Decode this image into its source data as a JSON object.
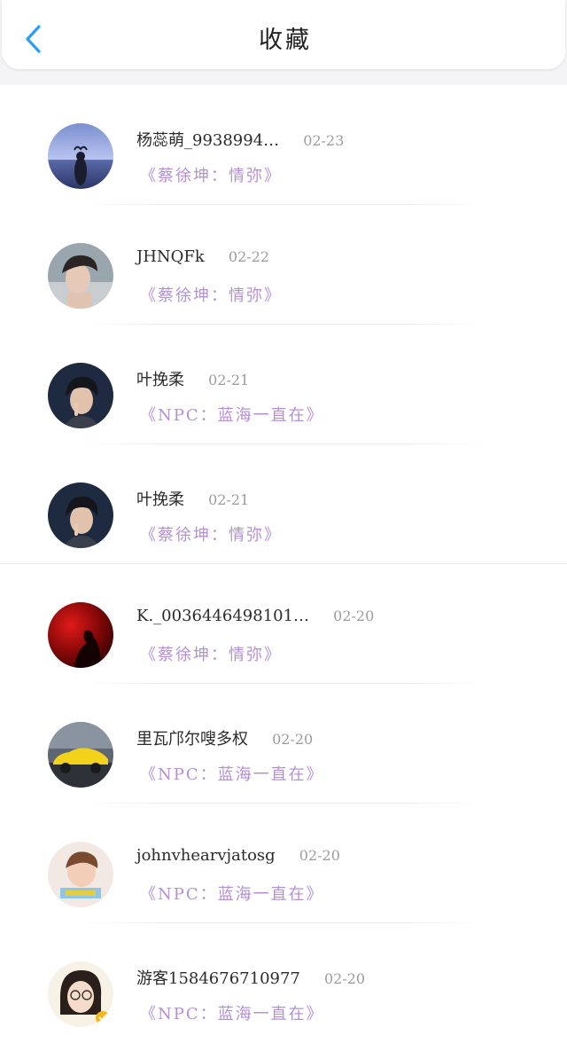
{
  "header": {
    "title": "收藏",
    "back_icon": "chevron-left-icon",
    "accent_color": "#2a9df4"
  },
  "link_color": "#b48fd8",
  "favorites": [
    {
      "username": "杨蕊萌_9938994…",
      "date": "02-23",
      "work": "《蔡徐坤：情弥》",
      "avatar": "sunset-heart-photo"
    },
    {
      "username": "JHNQFk",
      "date": "02-22",
      "work": "《蔡徐坤：情弥》",
      "avatar": "boy-portrait-photo"
    },
    {
      "username": "叶挽柔",
      "date": "02-21",
      "work": "《NPC：蓝海一直在》",
      "avatar": "boy-shush-photo"
    },
    {
      "username": "叶挽柔",
      "date": "02-21",
      "work": "《蔡徐坤：情弥》",
      "avatar": "boy-shush-photo"
    },
    {
      "username": "K._0036446498101…",
      "date": "02-20",
      "work": "《蔡徐坤：情弥》",
      "avatar": "red-silhouette-photo"
    },
    {
      "username": "里瓦邝尔嗖多权",
      "date": "02-20",
      "work": "《NPC：蓝海一直在》",
      "avatar": "yellow-car-photo"
    },
    {
      "username": "johnvhearvjatosg",
      "date": "02-20",
      "work": "《NPC：蓝海一直在》",
      "avatar": "boy-cartoon-photo"
    },
    {
      "username": "游客1584676710977",
      "date": "02-20",
      "work": "《NPC：蓝海一直在》",
      "avatar": "girl-glasses-photo"
    }
  ]
}
